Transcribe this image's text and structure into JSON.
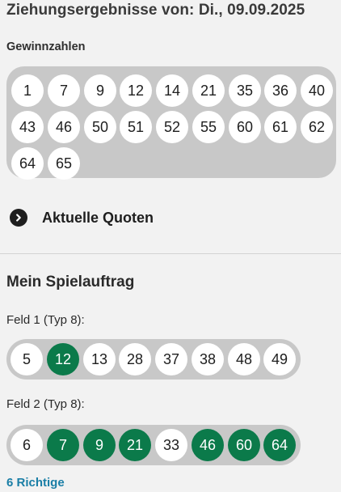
{
  "header": {
    "title": "Ziehungsergebnisse von: Di., 09.09.2025",
    "subtitle": "Gewinnzahlen"
  },
  "winning_numbers": [
    "1",
    "7",
    "9",
    "12",
    "14",
    "21",
    "35",
    "36",
    "40",
    "43",
    "46",
    "50",
    "51",
    "52",
    "55",
    "60",
    "61",
    "62",
    "64",
    "65"
  ],
  "quotes_link": {
    "label": "Aktuelle Quoten",
    "icon": "chevron-right-icon"
  },
  "my_order": {
    "title": "Mein Spielauftrag",
    "fields": [
      {
        "label": "Feld 1 (Typ 8):",
        "numbers": [
          {
            "n": "5",
            "hit": false
          },
          {
            "n": "12",
            "hit": true
          },
          {
            "n": "13",
            "hit": false
          },
          {
            "n": "28",
            "hit": false
          },
          {
            "n": "37",
            "hit": false
          },
          {
            "n": "38",
            "hit": false
          },
          {
            "n": "48",
            "hit": false
          },
          {
            "n": "49",
            "hit": false
          }
        ]
      },
      {
        "label": "Feld 2 (Typ 8):",
        "numbers": [
          {
            "n": "6",
            "hit": false
          },
          {
            "n": "7",
            "hit": true
          },
          {
            "n": "9",
            "hit": true
          },
          {
            "n": "21",
            "hit": true
          },
          {
            "n": "33",
            "hit": false
          },
          {
            "n": "46",
            "hit": true
          },
          {
            "n": "60",
            "hit": true
          },
          {
            "n": "64",
            "hit": true
          }
        ]
      }
    ],
    "result_label": "6 Richtige"
  },
  "colors": {
    "hit": "#0b7a4a",
    "panel": "#c8c8c8",
    "link": "#1a7ea6",
    "background": "#f2f2f2"
  }
}
